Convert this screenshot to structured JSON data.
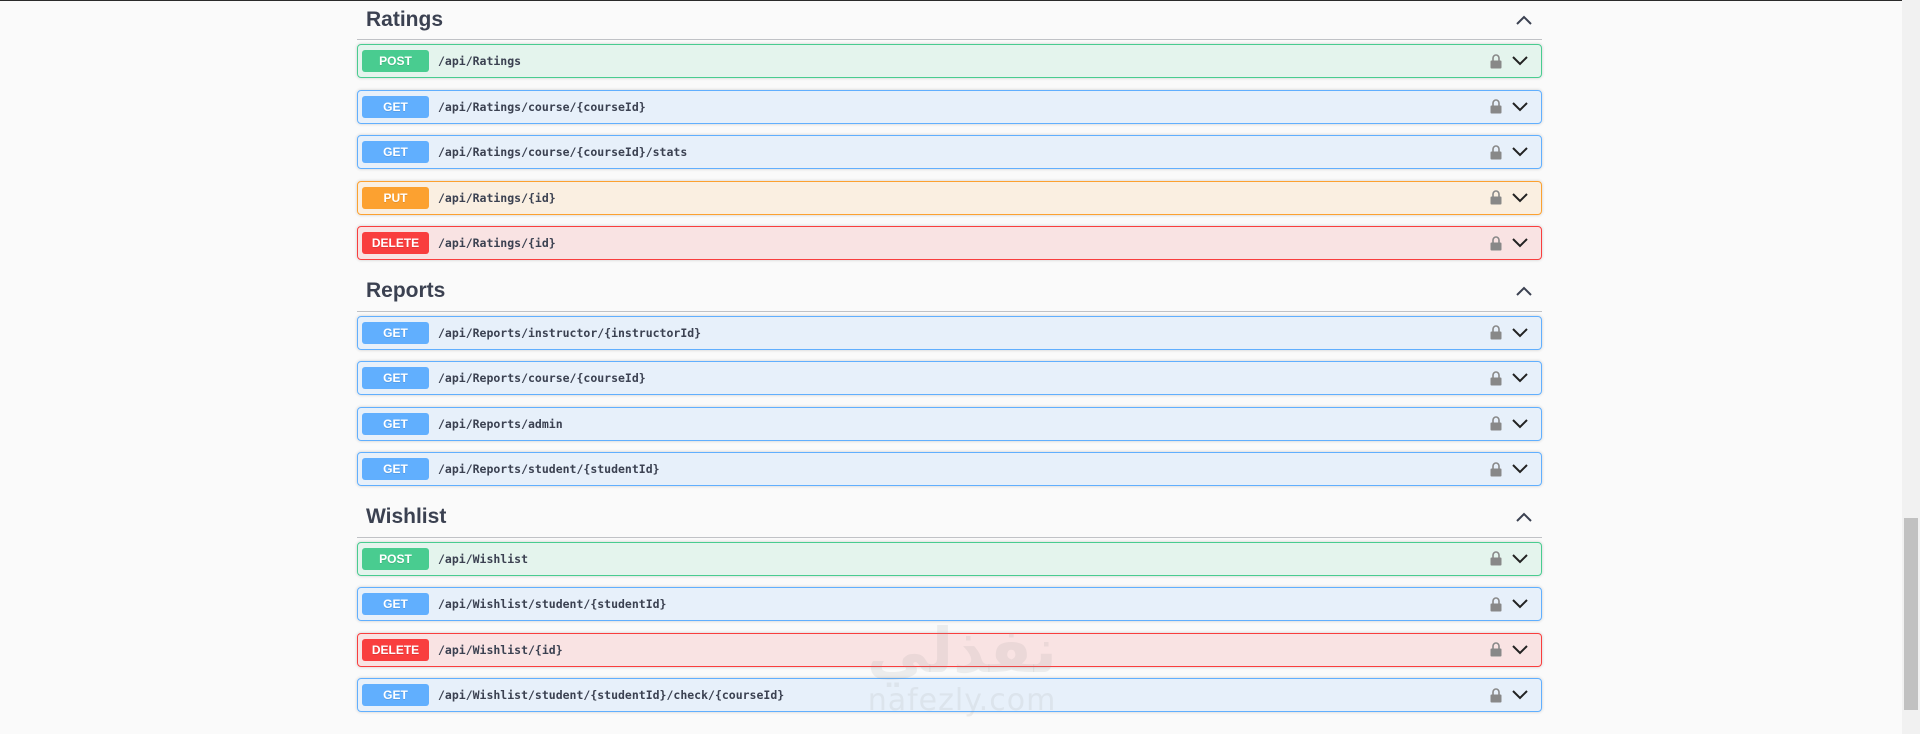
{
  "sections": [
    {
      "title": "Ratings",
      "operations": [
        {
          "method": "POST",
          "path": "/api/Ratings"
        },
        {
          "method": "GET",
          "path": "/api/Ratings/course/{courseId}"
        },
        {
          "method": "GET",
          "path": "/api/Ratings/course/{courseId}/stats"
        },
        {
          "method": "PUT",
          "path": "/api/Ratings/{id}"
        },
        {
          "method": "DELETE",
          "path": "/api/Ratings/{id}"
        }
      ]
    },
    {
      "title": "Reports",
      "operations": [
        {
          "method": "GET",
          "path": "/api/Reports/instructor/{instructorId}"
        },
        {
          "method": "GET",
          "path": "/api/Reports/course/{courseId}"
        },
        {
          "method": "GET",
          "path": "/api/Reports/admin"
        },
        {
          "method": "GET",
          "path": "/api/Reports/student/{studentId}"
        }
      ]
    },
    {
      "title": "Wishlist",
      "operations": [
        {
          "method": "POST",
          "path": "/api/Wishlist"
        },
        {
          "method": "GET",
          "path": "/api/Wishlist/student/{studentId}"
        },
        {
          "method": "DELETE",
          "path": "/api/Wishlist/{id}"
        },
        {
          "method": "GET",
          "path": "/api/Wishlist/student/{studentId}/check/{courseId}"
        }
      ]
    }
  ],
  "watermark": {
    "glyph": "نفذلي",
    "text": "nafezly.com"
  },
  "colors": {
    "post": "#49cc90",
    "get": "#61affe",
    "put": "#fca130",
    "delete": "#f93e3e",
    "background": "#fafafa",
    "text": "#3b4151"
  },
  "icons": {
    "lock": "lock-icon",
    "expand": "chevron-down-icon",
    "collapse": "chevron-up-icon"
  }
}
